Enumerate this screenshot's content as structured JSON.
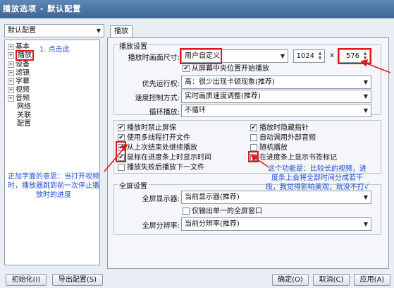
{
  "window": {
    "title": "播放选项 - 默认配置"
  },
  "profile_select": {
    "value": "默认配置"
  },
  "tree": {
    "items": [
      "基本",
      "播放",
      "设备",
      "滤镜",
      "字幕",
      "视频",
      "音频",
      "网络",
      "关联",
      "配置"
    ],
    "expander_plus": "+",
    "expander_minus": "-"
  },
  "annotations": {
    "step1": "1. 点击此",
    "left_note": "正加字面的意思：当打开视频时，播放器跳到前一次停止播放时的进度",
    "right_note": "这个功能是：比较长的视频，进度条上会将全部时间分成若干段，我觉得影响美观，就没不打√"
  },
  "tab": {
    "label": "播放"
  },
  "playback_settings": {
    "group_label": "播放设置",
    "size_label": "播放时画面尺寸:",
    "size_value": "用户自定义",
    "width": "1024",
    "x_sep": "x",
    "height": "576",
    "center_label": "从屏幕中央位置开始播放",
    "priority_label": "优先运行权:",
    "priority_value": "高：很少出现卡顿现象(推荐)",
    "speed_label": "速度控制方式:",
    "speed_value": "实时画质速度调整(推荐)",
    "loop_label": "循环播放:",
    "loop_value": "不循环"
  },
  "options": {
    "left": [
      {
        "label": "播放时禁止屏保",
        "checked": true
      },
      {
        "label": "使用多线程打开文件",
        "checked": true
      },
      {
        "label": "从上次结束处继续播放",
        "checked": true
      },
      {
        "label": "鼠标在进度条上时显示时间",
        "checked": true
      },
      {
        "label": "播放失败后播放下一文件",
        "checked": false
      }
    ],
    "right": [
      {
        "label": "播放时隐藏指针",
        "checked": true
      },
      {
        "label": "自动调用外部音频",
        "checked": false
      },
      {
        "label": "随机播放",
        "checked": false
      },
      {
        "label": "在进度条上显示书签标记",
        "checked": false
      }
    ],
    "checkmark": "✔"
  },
  "fullscreen": {
    "group_label": "全屏设置",
    "monitor_label": "全屏显示器:",
    "monitor_value": "当前显示器(推荐)",
    "single_window_label": "仅输出单一的全屏窗口",
    "resolution_label": "全屏分辨率:",
    "resolution_value": "当前分辨率(推荐)"
  },
  "buttons": {
    "init": "初始化(I)",
    "export": "导出配置(S)",
    "ok": "确定(O)",
    "cancel": "取消(C)",
    "apply": "应用(A)"
  },
  "icons": {
    "dropdown": "chevron-down-icon",
    "spin": "spin-arrows-icon"
  },
  "colors": {
    "highlight": "#e8151c",
    "annotation": "#1b4bd6",
    "titlebar": "#4a72a0"
  }
}
